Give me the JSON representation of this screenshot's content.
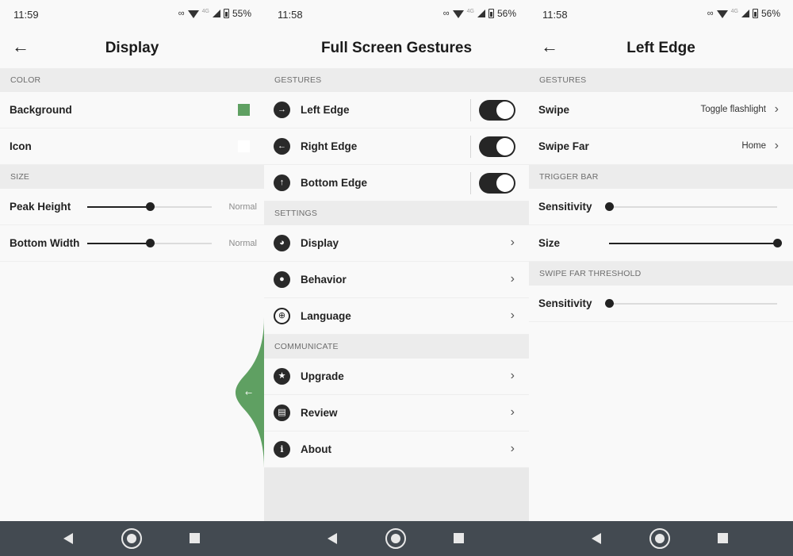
{
  "screens": [
    {
      "status": {
        "time": "11:59",
        "battery": "55%",
        "network": "4G"
      },
      "title": "Display",
      "sections": {
        "color": "COLOR",
        "size": "SIZE"
      },
      "rows": {
        "background": {
          "label": "Background",
          "color": "#5fa062"
        },
        "icon": {
          "label": "Icon",
          "color": "#ffffff"
        },
        "peak_height": {
          "label": "Peak Height",
          "value_text": "Normal",
          "level": 0.5
        },
        "bottom_width": {
          "label": "Bottom Width",
          "value_text": "Normal",
          "level": 0.5
        }
      }
    },
    {
      "status": {
        "time": "11:58",
        "battery": "56%",
        "network": "4G"
      },
      "title": "Full Screen Gestures",
      "sections": {
        "gestures": "GESTURES",
        "settings": "SETTINGS",
        "communicate": "COMMUNICATE"
      },
      "gestures": [
        {
          "label": "Left Edge",
          "icon": "arrow-right-circle-icon",
          "enabled": true
        },
        {
          "label": "Right Edge",
          "icon": "arrow-left-circle-icon",
          "enabled": true
        },
        {
          "label": "Bottom Edge",
          "icon": "arrow-up-circle-icon",
          "enabled": true
        }
      ],
      "settings": [
        {
          "label": "Display",
          "icon": "palette-icon"
        },
        {
          "label": "Behavior",
          "icon": "account-circle-icon"
        },
        {
          "label": "Language",
          "icon": "globe-icon"
        }
      ],
      "communicate": [
        {
          "label": "Upgrade",
          "icon": "star-circle-icon"
        },
        {
          "label": "Review",
          "icon": "review-icon"
        },
        {
          "label": "About",
          "icon": "info-icon"
        }
      ]
    },
    {
      "status": {
        "time": "11:58",
        "battery": "56%",
        "network": "4G"
      },
      "title": "Left Edge",
      "sections": {
        "gestures": "GESTURES",
        "trigger_bar": "TRIGGER BAR",
        "swipe_far_threshold": "SWIPE FAR THRESHOLD"
      },
      "rows": {
        "swipe": {
          "label": "Swipe",
          "value": "Toggle flashlight"
        },
        "swipe_far": {
          "label": "Swipe Far",
          "value": "Home"
        },
        "sensitivity": {
          "label": "Sensitivity",
          "level": 0.0
        },
        "size": {
          "label": "Size",
          "level": 1.0
        },
        "far_sensitivity": {
          "label": "Sensitivity",
          "level": 0.0
        }
      }
    }
  ],
  "colors": {
    "accent_green": "#5fa062",
    "toggle_on": "#262626",
    "navbar": "#434a51"
  },
  "edge_trigger": {
    "icon": "arrow-left-icon"
  },
  "navbar": {
    "buttons": [
      "back-icon",
      "home-icon",
      "recents-icon"
    ]
  }
}
